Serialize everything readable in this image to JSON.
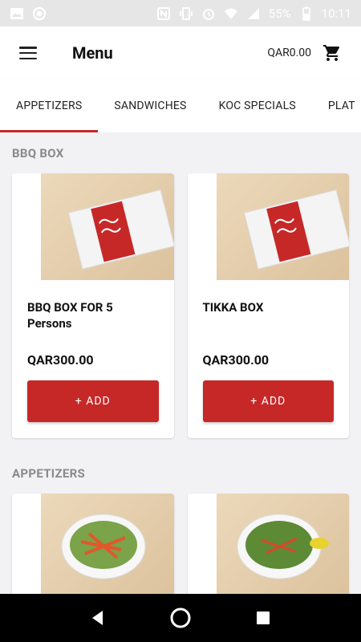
{
  "status_bar": {
    "battery": "55%",
    "time": "10:11"
  },
  "app_bar": {
    "title": "Menu",
    "cart_total": "QAR0.00"
  },
  "tabs": [
    {
      "label": "APPETIZERS",
      "active": true
    },
    {
      "label": "SANDWICHES",
      "active": false
    },
    {
      "label": "KOC SPECIALS",
      "active": false
    },
    {
      "label": "PLAT",
      "active": false
    }
  ],
  "sections": [
    {
      "title": "BBQ BOX",
      "items": [
        {
          "name": "BBQ BOX FOR 5 Persons",
          "price": "QAR300.00",
          "add_label": "+ ADD"
        },
        {
          "name": "TIKKA BOX",
          "price": "QAR300.00",
          "add_label": "+ ADD"
        }
      ]
    },
    {
      "title": "APPETIZERS",
      "items": [
        {
          "name": "",
          "price": "",
          "add_label": ""
        },
        {
          "name": "",
          "price": "",
          "add_label": ""
        }
      ]
    }
  ],
  "colors": {
    "accent": "#c62828",
    "status_bar": "#e6e6e6",
    "nav_bar": "#000000"
  }
}
